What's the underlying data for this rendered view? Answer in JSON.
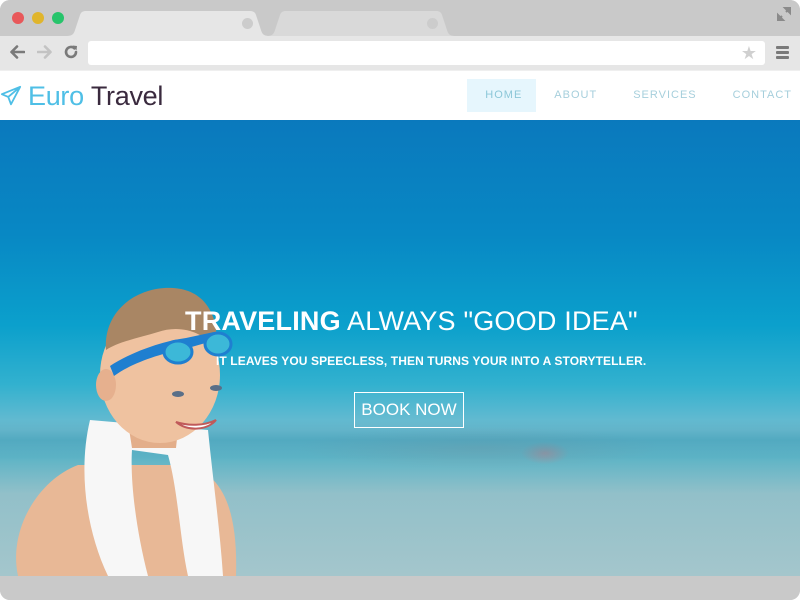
{
  "browser": {
    "tabs": [
      {
        "label": "",
        "active": true
      },
      {
        "label": "",
        "active": false
      }
    ],
    "url": "",
    "icons": {
      "window_controls": [
        "close-dot",
        "minimize-dot",
        "maximize-dot"
      ],
      "expand": "expand-arrows-icon",
      "back": "arrow-left-icon",
      "forward": "arrow-right-icon",
      "reload": "reload-icon",
      "bookmark": "star-icon",
      "menu": "hamburger-menu-icon"
    },
    "star_glyph": "★"
  },
  "site": {
    "logo": {
      "icon": "paper-plane-icon",
      "word1": "Euro",
      "word2": "Travel"
    },
    "nav": [
      {
        "label": "HOME",
        "active": true
      },
      {
        "label": "ABOUT",
        "active": false
      },
      {
        "label": "SERVICES",
        "active": false
      },
      {
        "label": "CONTACT",
        "active": false
      }
    ],
    "hero": {
      "headline_bold": "TRAVELING",
      "headline_rest": " ALWAYS \"GOOD IDEA\"",
      "subline": "IT LEAVES YOU SPEECLESS, THEN TURNS YOUR INTO A STORYTELLER.",
      "cta_label": "BOOK NOW",
      "image": "boy-with-goggles-and-towel"
    }
  },
  "colors": {
    "brand_light": "#4fbfe6",
    "brand_dark": "#3a2a3e",
    "nav_text": "#a6cfdc",
    "nav_active_bg": "#e6f6fd",
    "hero_top": "#0a79bd",
    "hero_bottom": "#a4c6cc"
  }
}
